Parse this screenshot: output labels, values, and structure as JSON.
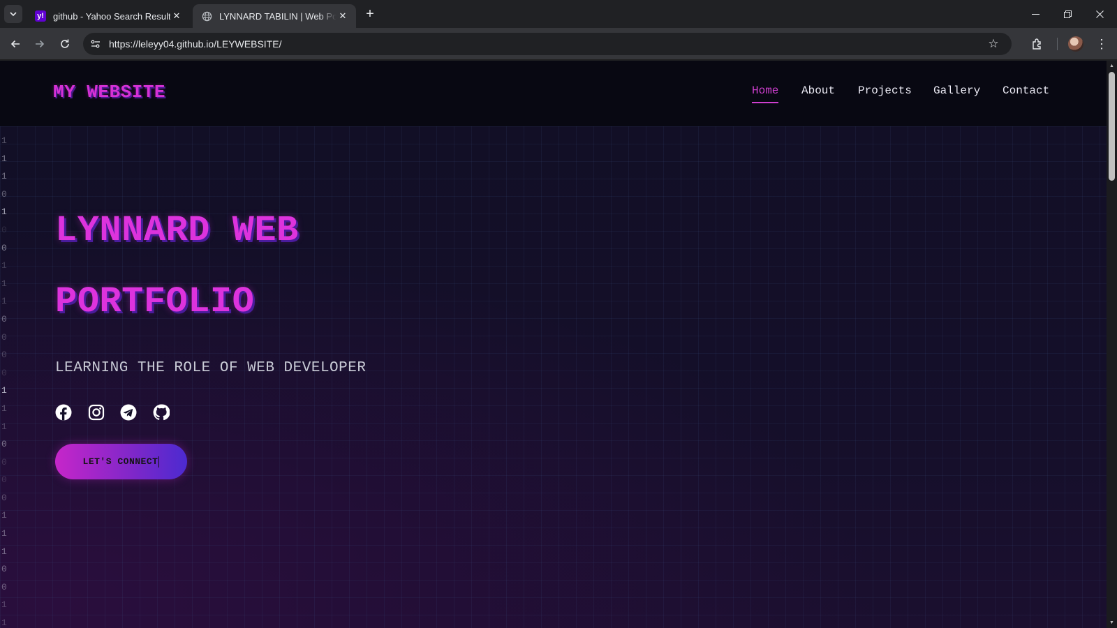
{
  "browser": {
    "tabs": [
      {
        "title": "github - Yahoo Search Results",
        "favicon": "yahoo-icon",
        "active": false
      },
      {
        "title": "LYNNARD TABILIN | Web Portfolio",
        "favicon": "globe-icon",
        "active": true
      }
    ],
    "url": "https://leleyy04.github.io/LEYWEBSITE/",
    "url_host": "https://leleyy04.github.io",
    "url_path": "/LEYWEBSITE/"
  },
  "site": {
    "logo": "MY WEBSITE",
    "nav": [
      {
        "label": "Home",
        "active": true
      },
      {
        "label": "About",
        "active": false
      },
      {
        "label": "Projects",
        "active": false
      },
      {
        "label": "Gallery",
        "active": false
      },
      {
        "label": "Contact",
        "active": false
      }
    ],
    "hero": {
      "title_line1": "LYNNARD WEB",
      "title_line2": "PORTFOLIO",
      "subtitle": "LEARNING THE ROLE OF WEB DEVELOPER",
      "socials": [
        "facebook-icon",
        "instagram-icon",
        "telegram-icon",
        "github-icon"
      ],
      "cta_label": "LET'S CONNECT"
    },
    "binary_column": [
      "1",
      "1",
      "1",
      "0",
      "1",
      "0",
      "0",
      "1",
      "1",
      "1",
      "0",
      "0",
      "0",
      "0",
      "1",
      "1",
      "1",
      "0",
      "0",
      "0",
      "0",
      "1",
      "1",
      "1",
      "0",
      "0",
      "1",
      "1"
    ],
    "colors": {
      "accent": "#dd33dd",
      "accent_shadow": "#4a1c9c",
      "header_bg": "#080812",
      "hero_bg": "#130f28",
      "button_gradient_start": "#c626c9",
      "button_gradient_end": "#4c2ad0"
    }
  }
}
